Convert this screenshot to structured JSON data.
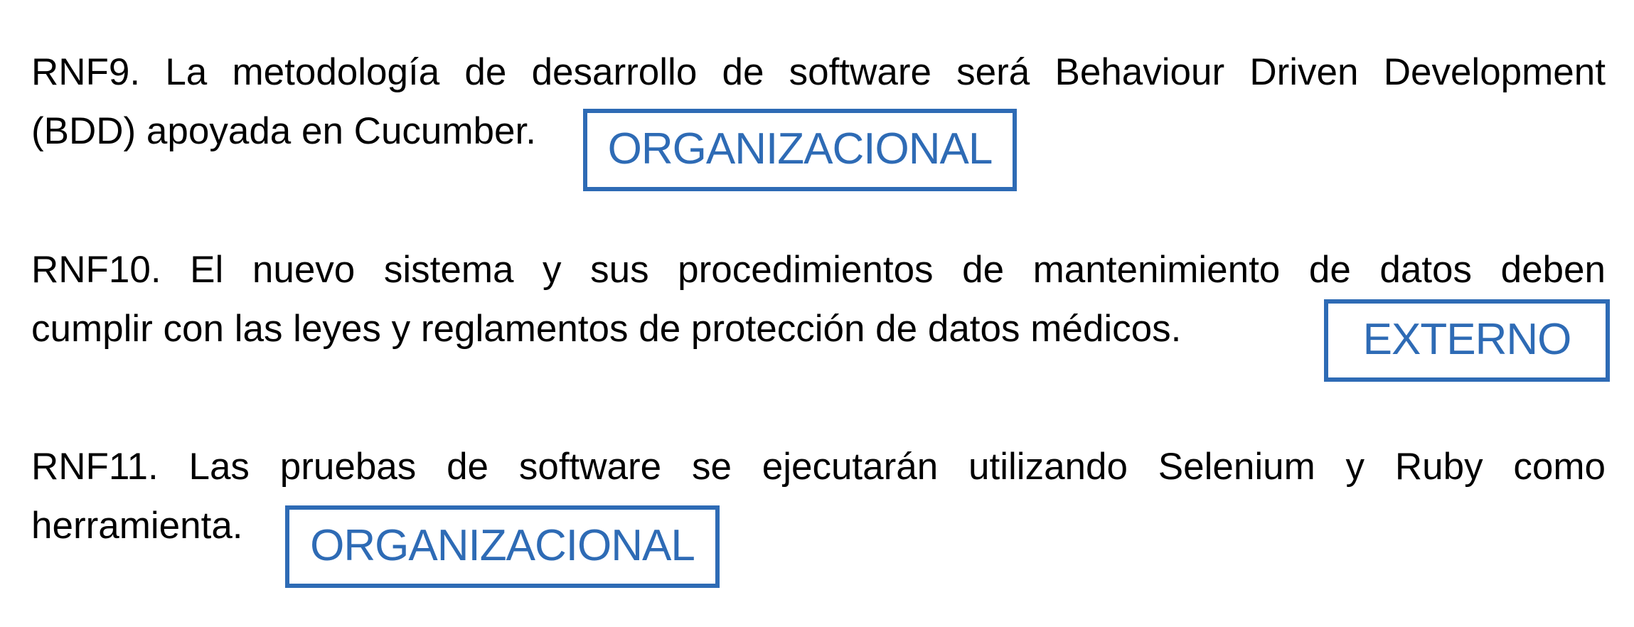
{
  "requirements": [
    {
      "line1": "RNF9. La metodología de desarrollo de software será Behaviour Driven Development",
      "line2": "(BDD) apoyada en Cucumber.",
      "tag": "ORGANIZACIONAL"
    },
    {
      "line1": "RNF10. El nuevo sistema y sus procedimientos de mantenimiento de datos deben",
      "line2": "cumplir con las leyes y reglamentos de protección de datos médicos.",
      "tag": "EXTERNO"
    },
    {
      "line1": "RNF11. Las pruebas de software se ejecutarán utilizando Selenium y Ruby como",
      "line2": "herramienta.",
      "tag": "ORGANIZACIONAL"
    }
  ],
  "colors": {
    "text": "#000000",
    "tag": "#2e6bb5",
    "background": "#ffffff"
  }
}
